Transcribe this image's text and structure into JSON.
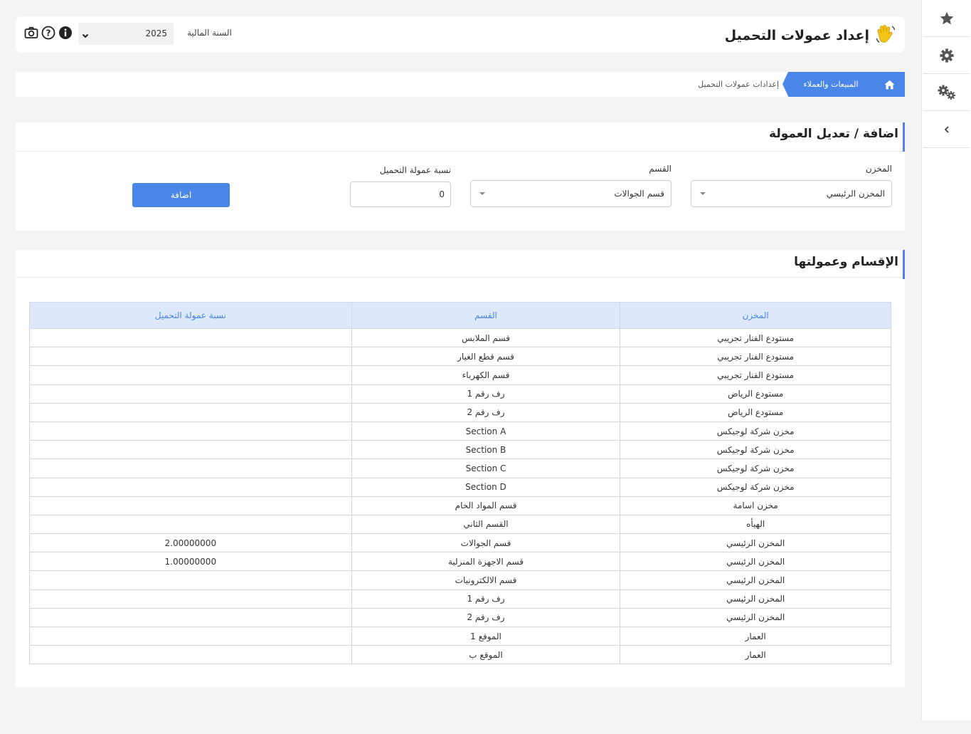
{
  "header": {
    "title": "إعداد عمولات التحميل",
    "fiscal_year_label": "السنة المالية",
    "fiscal_year_value": "2025"
  },
  "breadcrumb": {
    "items": [
      "المبيعات والعملاء",
      "إعدادات عمولات التحميل"
    ]
  },
  "form": {
    "title": "اضافة / تعديل العمولة",
    "warehouse_label": "المخزن",
    "warehouse_value": "المخزن الرئيسي",
    "section_label": "القسم",
    "section_value": "قسم الجوالات",
    "commission_label": "نسبة عمولة التحميل",
    "commission_value": "0",
    "add_label": "اضافة"
  },
  "table": {
    "title": "الإقسام وعمولتها",
    "headers": [
      "المخزن",
      "القسم",
      "نسبة عمولة التحميل"
    ],
    "rows": [
      [
        "مستودع الفنار تجريبي",
        "قسم الملابس",
        ""
      ],
      [
        "مستودع الفنار تجريبي",
        "قسم قطع الغيار",
        ""
      ],
      [
        "مستودع الفنار تجريبي",
        "قسم الكهرباء",
        ""
      ],
      [
        "مستودع الرياض",
        "رف رقم 1",
        ""
      ],
      [
        "مستودع الرياض",
        "رف رقم 2",
        ""
      ],
      [
        "مخزن شركة لوجيكس",
        "Section A",
        ""
      ],
      [
        "مخزن شركة لوجيكس",
        "Section B",
        ""
      ],
      [
        "مخزن شركة لوجيكس",
        "Section C",
        ""
      ],
      [
        "مخزن شركة لوجيكس",
        "Section D",
        ""
      ],
      [
        "مخزن اسامة",
        "قسم المواد الخام",
        ""
      ],
      [
        "الهيأه",
        "القسم الثاني",
        ""
      ],
      [
        "المخزن الرئيسي",
        "قسم الجوالات",
        "2.00000000"
      ],
      [
        "المخزن الرئيسي",
        "قسم الاجهزة المنزلية",
        "1.00000000"
      ],
      [
        "المخزن الرئيسي",
        "قسم الالكترونيات",
        ""
      ],
      [
        "المخزن الرئيسي",
        "رف رقم 1",
        ""
      ],
      [
        "المخزن الرئيسي",
        "رف رقم 2",
        ""
      ],
      [
        "العمار",
        "الموقع 1",
        ""
      ],
      [
        "العمار",
        "الموقع ب",
        ""
      ]
    ]
  },
  "icons": {
    "sidebar": [
      "star-icon",
      "gear-icon",
      "gears-icon",
      "chevron-left-icon"
    ],
    "topbar": [
      "info-icon",
      "help-icon",
      "camera-icon"
    ]
  },
  "colors": {
    "accent": "#4a86e8",
    "header_bg": "#dde8fb",
    "page_bg": "#f4f4f4"
  }
}
